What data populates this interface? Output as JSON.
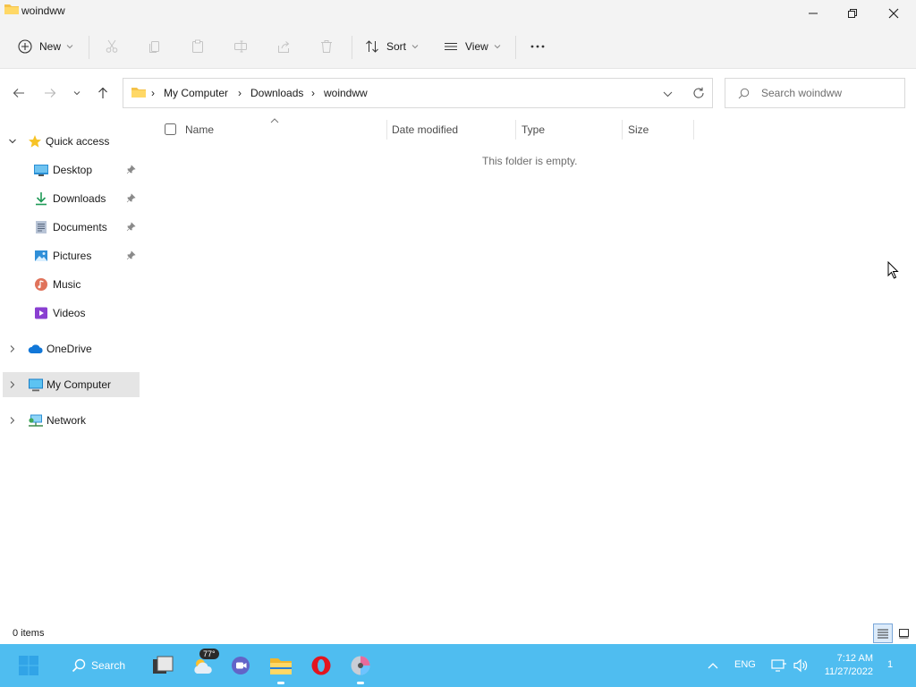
{
  "window": {
    "title": "woindww",
    "controls": [
      "minimize",
      "restore",
      "close"
    ]
  },
  "toolbar": {
    "new_label": "New",
    "sort_label": "Sort",
    "view_label": "View"
  },
  "address": {
    "crumbs": [
      "My Computer",
      "Downloads",
      "woindww"
    ]
  },
  "search": {
    "placeholder": "Search woindww"
  },
  "sidebar": {
    "quick_access": "Quick access",
    "items": [
      {
        "label": "Desktop",
        "icon": "desktop-icon",
        "pinned": true
      },
      {
        "label": "Downloads",
        "icon": "downloads-icon",
        "pinned": true
      },
      {
        "label": "Documents",
        "icon": "documents-icon",
        "pinned": true
      },
      {
        "label": "Pictures",
        "icon": "pictures-icon",
        "pinned": true
      },
      {
        "label": "Music",
        "icon": "music-icon",
        "pinned": false
      },
      {
        "label": "Videos",
        "icon": "videos-icon",
        "pinned": false
      }
    ],
    "onedrive": "OneDrive",
    "my_computer": "My Computer",
    "network": "Network"
  },
  "columns": {
    "name": "Name",
    "date_modified": "Date modified",
    "type": "Type",
    "size": "Size"
  },
  "content": {
    "empty_message": "This folder is empty."
  },
  "status": {
    "item_count": "0 items"
  },
  "taskbar": {
    "search_label": "Search",
    "weather_temp": "77°",
    "language": "ENG",
    "time": "7:12 AM",
    "date": "11/27/2022",
    "notification_count": "1"
  },
  "colors": {
    "taskbar_bg": "#4fbdf0",
    "selected_bg": "#e5e5e5",
    "folder_yellow": "#f5c34a",
    "accent_blue": "#0067c0"
  }
}
